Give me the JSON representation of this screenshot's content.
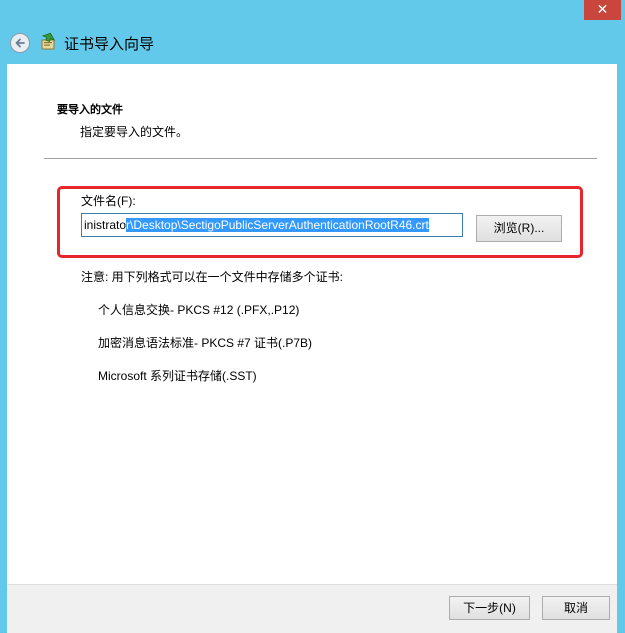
{
  "window": {
    "close_label": "✕",
    "title": "证书导入向导"
  },
  "section": {
    "heading": "要导入的文件",
    "subtitle": "指定要导入的文件。"
  },
  "file": {
    "label": "文件名(F):",
    "value_unselected": "inistrato",
    "value_selected": "r\\Desktop\\SectigoPublicServerAuthenticationRootR46.crt",
    "browse_label": "浏览(R)..."
  },
  "note": "注意: 用下列格式可以在一个文件中存储多个证书:",
  "formats": [
    "个人信息交换- PKCS #12 (.PFX,.P12)",
    "加密消息语法标准- PKCS #7 证书(.P7B)",
    "Microsoft 系列证书存储(.SST)"
  ],
  "buttons": {
    "next": "下一步(N)",
    "cancel": "取消"
  },
  "colors": {
    "frame": "#63c9ea",
    "close": "#c9463d",
    "highlight": "#e8262a",
    "selection": "#3399ff"
  },
  "icons": {
    "back": "back-arrow-icon",
    "wizard": "certificate-wizard-icon"
  }
}
